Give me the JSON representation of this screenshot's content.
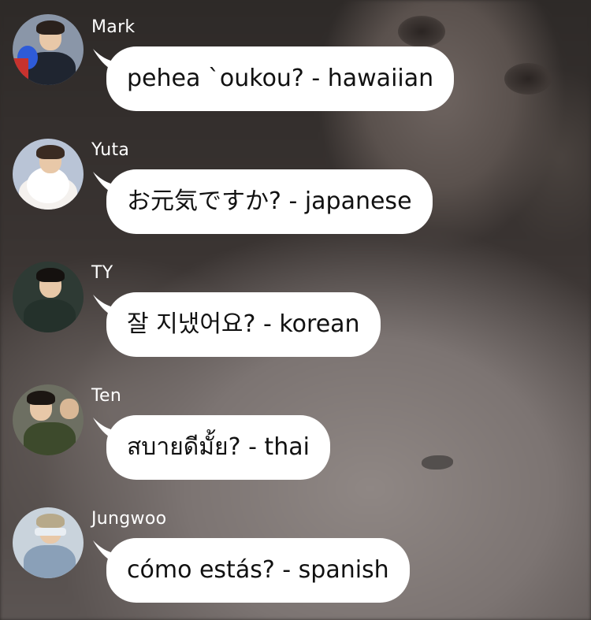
{
  "messages": [
    {
      "sender": "Mark",
      "text": "pehea `oukou? - hawaiian",
      "avatar_icon": "profile-photo"
    },
    {
      "sender": "Yuta",
      "text": "お元気ですか? - japanese",
      "avatar_icon": "profile-photo"
    },
    {
      "sender": "TY",
      "text": "잘 지냈어요? - korean",
      "avatar_icon": "profile-photo"
    },
    {
      "sender": "Ten",
      "text": "สบายดีมั้ย? - thai",
      "avatar_icon": "profile-photo"
    },
    {
      "sender": "Jungwoo",
      "text": "cómo estás? - spanish",
      "avatar_icon": "profile-photo"
    }
  ],
  "colors": {
    "bubble": "#ffffff",
    "bubble_text": "#111111",
    "name_text": "#ffffff"
  }
}
